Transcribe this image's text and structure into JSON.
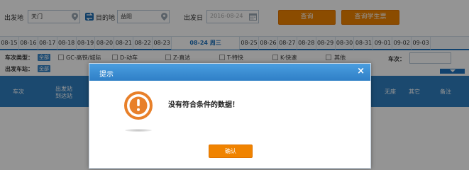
{
  "search": {
    "from_label": "出发地",
    "from_value": "天门",
    "to_label": "目的地",
    "to_value": "益阳",
    "date_label": "出发日",
    "date_placeholder": "2016-08-24",
    "query_button": "查询",
    "student_button": "查询学生票"
  },
  "dates": [
    {
      "label": "08-15"
    },
    {
      "label": "08-16"
    },
    {
      "label": "08-17"
    },
    {
      "label": "08-18"
    },
    {
      "label": "08-19"
    },
    {
      "label": "08-20"
    },
    {
      "label": "08-21"
    },
    {
      "label": "08-22"
    },
    {
      "label": "08-23"
    },
    {
      "label": "08-24 周三"
    },
    {
      "label": "08-25"
    },
    {
      "label": "08-26"
    },
    {
      "label": "08-27"
    },
    {
      "label": "08-28"
    },
    {
      "label": "08-29"
    },
    {
      "label": "08-30"
    },
    {
      "label": "08-31"
    },
    {
      "label": "09-01"
    },
    {
      "label": "09-02"
    },
    {
      "label": "09-03"
    }
  ],
  "filters": {
    "train_type_label": "车次类型：",
    "all_label": "全部",
    "types": [
      "GC-高铁/城际",
      "D-动车",
      "Z-直达",
      "T-特快",
      "K-快速",
      "其他"
    ],
    "station_label": "出发车站：",
    "train_no_label": "车次："
  },
  "table": {
    "col_train": "车次",
    "col_station_top": "出发站",
    "col_station_bottom": "到达站",
    "col_noseat": "无座",
    "col_other": "其它",
    "col_remark": "备注"
  },
  "dialog": {
    "title": "提示",
    "close": "×",
    "message": "没有符合条件的数据！",
    "ok_button": "确认"
  },
  "colors": {
    "accent": "#f08300",
    "primary": "#2f7fc0"
  }
}
